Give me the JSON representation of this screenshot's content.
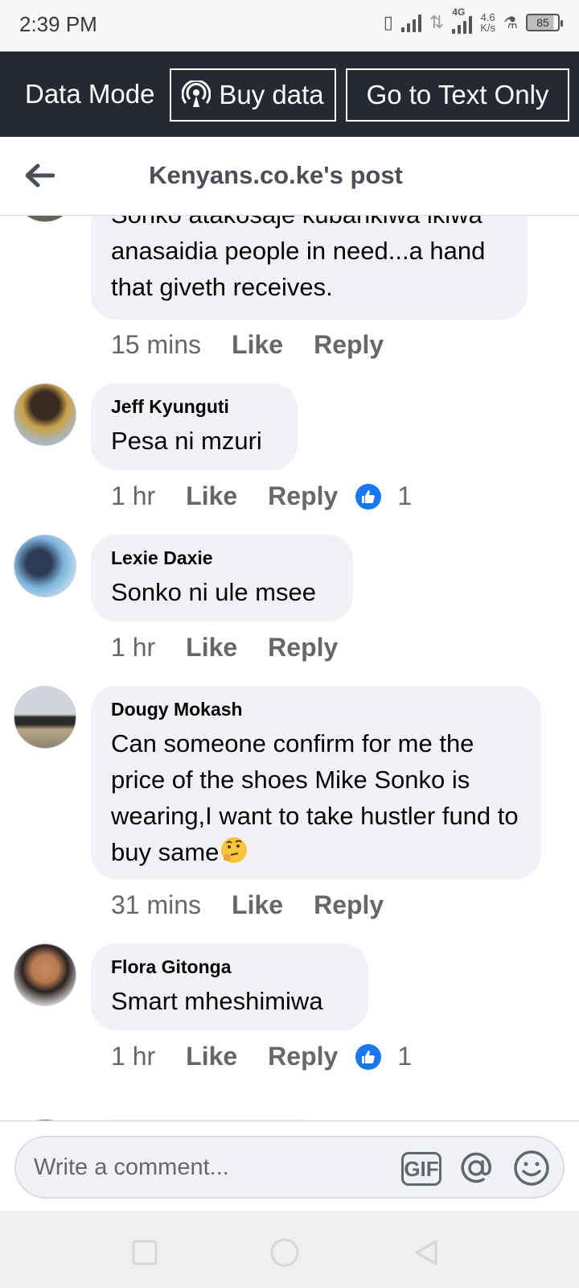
{
  "status_bar": {
    "time": "2:39 PM",
    "network_type": "4G",
    "speed_value": "4.6",
    "speed_unit": "K/s",
    "battery": "85"
  },
  "data_bar": {
    "mode_label": "Data Mode",
    "buy_data_label": "Buy data",
    "text_only_label": "Go to Text Only"
  },
  "header": {
    "title": "Kenyans.co.ke's post"
  },
  "comments": [
    {
      "author": "",
      "text": "Sonko atakosaje kubarikiwa ikiwa anasaidia people in need...a hand that giveth receives.",
      "time": "15 mins",
      "like_label": "Like",
      "reply_label": "Reply",
      "reactions": ""
    },
    {
      "author": "Jeff Kyunguti",
      "text": "Pesa ni mzuri",
      "time": "1 hr",
      "like_label": "Like",
      "reply_label": "Reply",
      "reactions": "1"
    },
    {
      "author": "Lexie Daxie",
      "text": "Sonko ni ule msee",
      "time": "1 hr",
      "like_label": "Like",
      "reply_label": "Reply",
      "reactions": ""
    },
    {
      "author": "Dougy Mokash",
      "text": "Can someone confirm for me the price of the shoes Mike Sonko is wearing,I want to take hustler fund to buy same",
      "time": "31 mins",
      "like_label": "Like",
      "reply_label": "Reply",
      "reactions": ""
    },
    {
      "author": "Flora Gitonga",
      "text": "Smart mheshimiwa",
      "time": "1 hr",
      "like_label": "Like",
      "reply_label": "Reply",
      "reactions": "1"
    }
  ],
  "composer": {
    "placeholder": "Write a comment...",
    "gif_label": "GIF"
  },
  "colors": {
    "data_bar_bg": "#242933",
    "like_blue": "#1877f2",
    "bubble_bg": "#f0f2f5",
    "meta_gray": "#65676b"
  },
  "icons": [
    "back-arrow-icon",
    "broadcast-icon",
    "like-thumb-icon",
    "thinking-face-emoji",
    "gif-icon",
    "at-icon",
    "emoji-icon",
    "nav-recents-icon",
    "nav-home-icon",
    "nav-back-icon"
  ]
}
